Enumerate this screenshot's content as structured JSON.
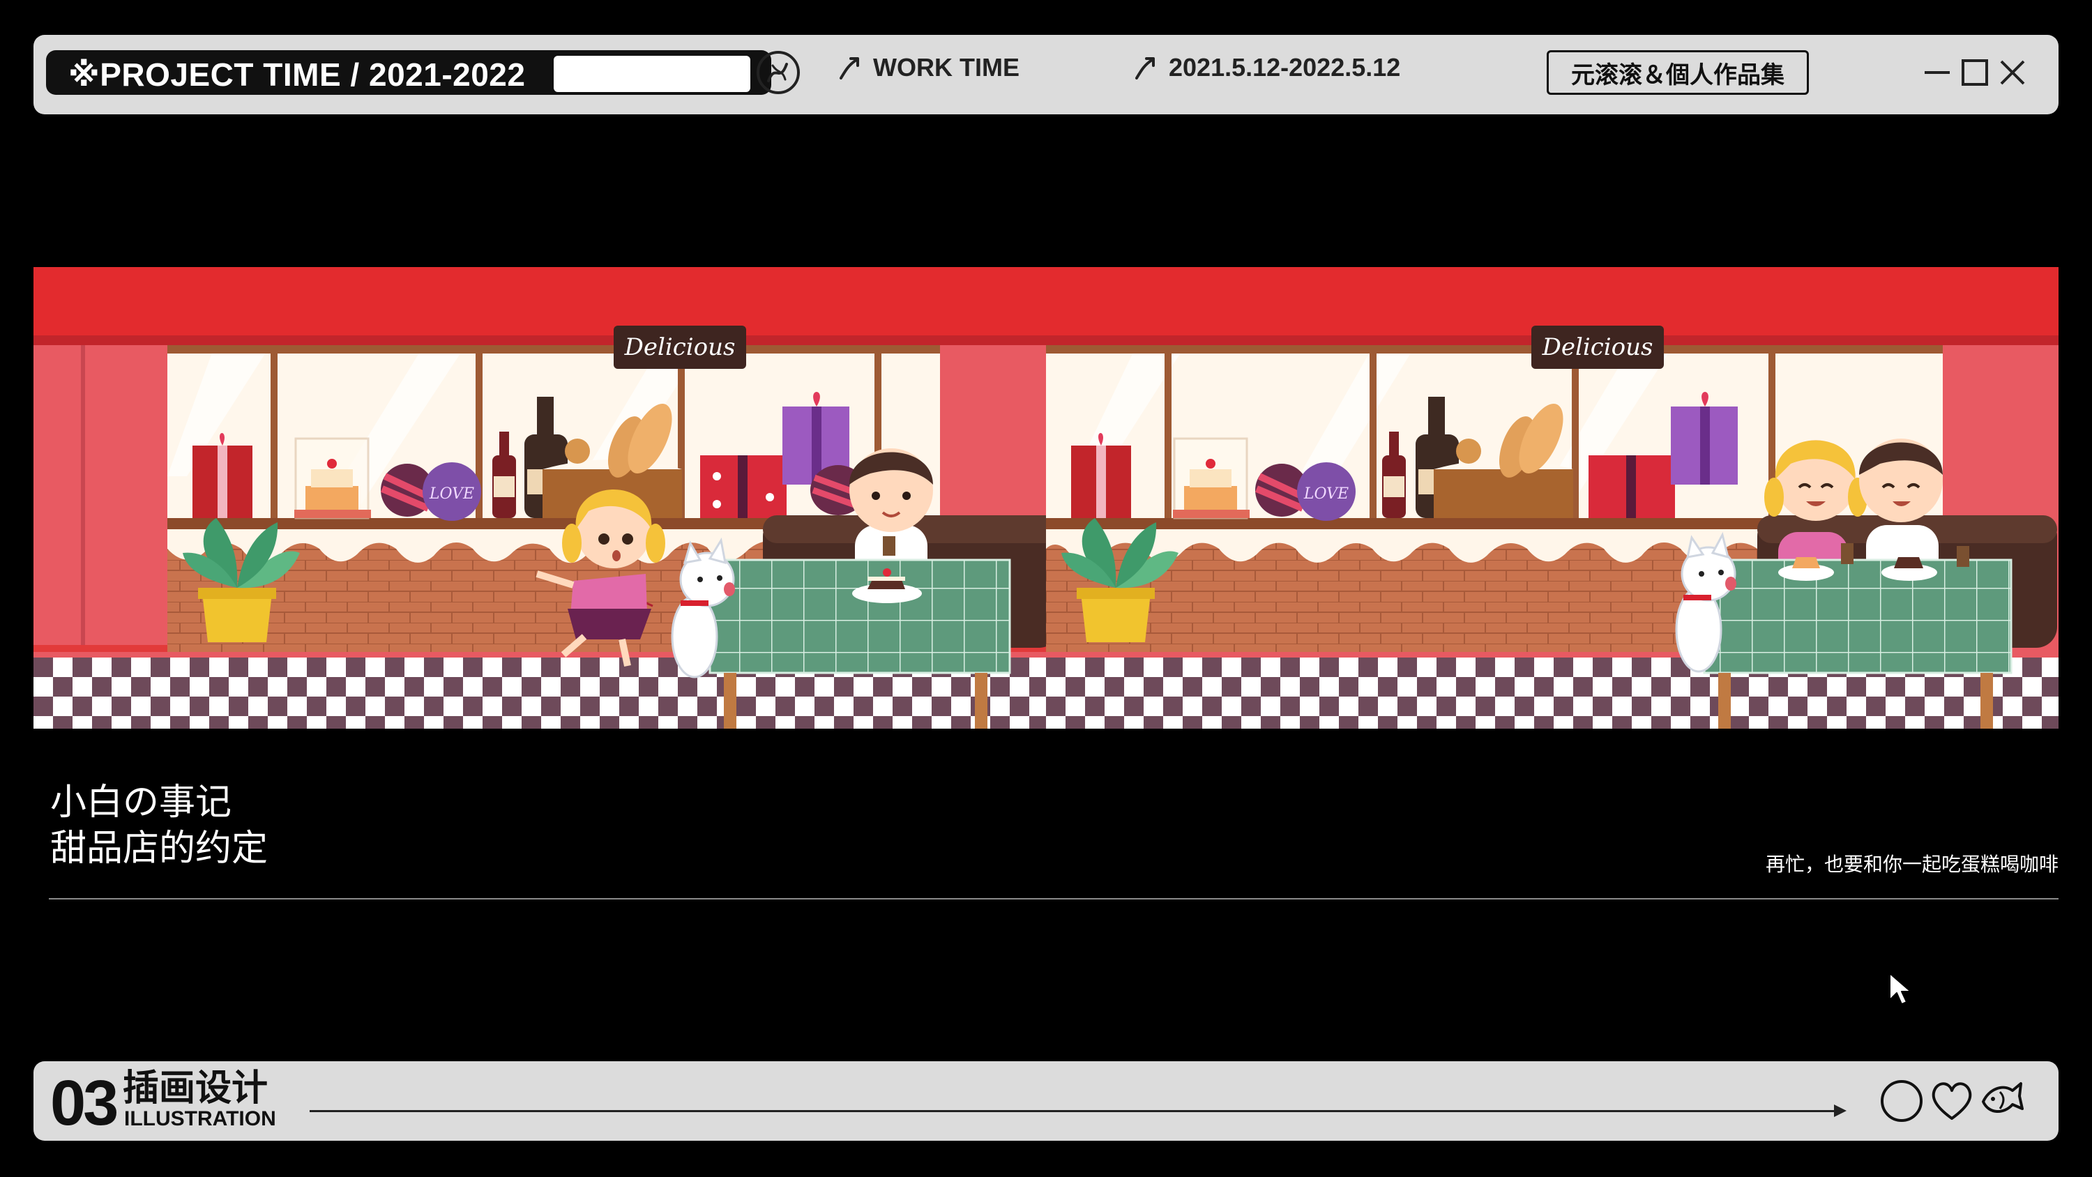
{
  "header": {
    "project_title": "※PROJECT TIME / 2021-2022",
    "work_time_label": "WORK TIME",
    "date_range": "2021.5.12-2022.5.12",
    "brand": "元滚滚＆個人作品集"
  },
  "icons": {
    "swirl": "swirl-icon",
    "arrow": "curved-arrow-icon",
    "minimize": "minimize-icon",
    "maximize": "maximize-icon",
    "close": "close-icon",
    "circle": "circle-icon",
    "heart": "heart-icon",
    "fish": "fish-icon",
    "cursor": "mouse-cursor-icon"
  },
  "illustration": {
    "sign_left": "Delicious",
    "sign_right": "Delicious",
    "candy_label": "LOVE"
  },
  "caption": {
    "title_line1": "小白の事记",
    "title_line2": "甜品店的约定",
    "subtitle": "再忙，也要和你一起吃蛋糕喝咖啡"
  },
  "footer": {
    "section_number": "03",
    "section_title_cn": "插画设计",
    "section_title_en": "ILLUSTRATION"
  },
  "colors": {
    "background": "#000000",
    "bar": "#dcdcdc",
    "awning_red": "#e23a3a",
    "wall_pink": "#e85a62",
    "tablecloth_green": "#5e9a7c",
    "floor_dark": "#6e4a5a"
  }
}
